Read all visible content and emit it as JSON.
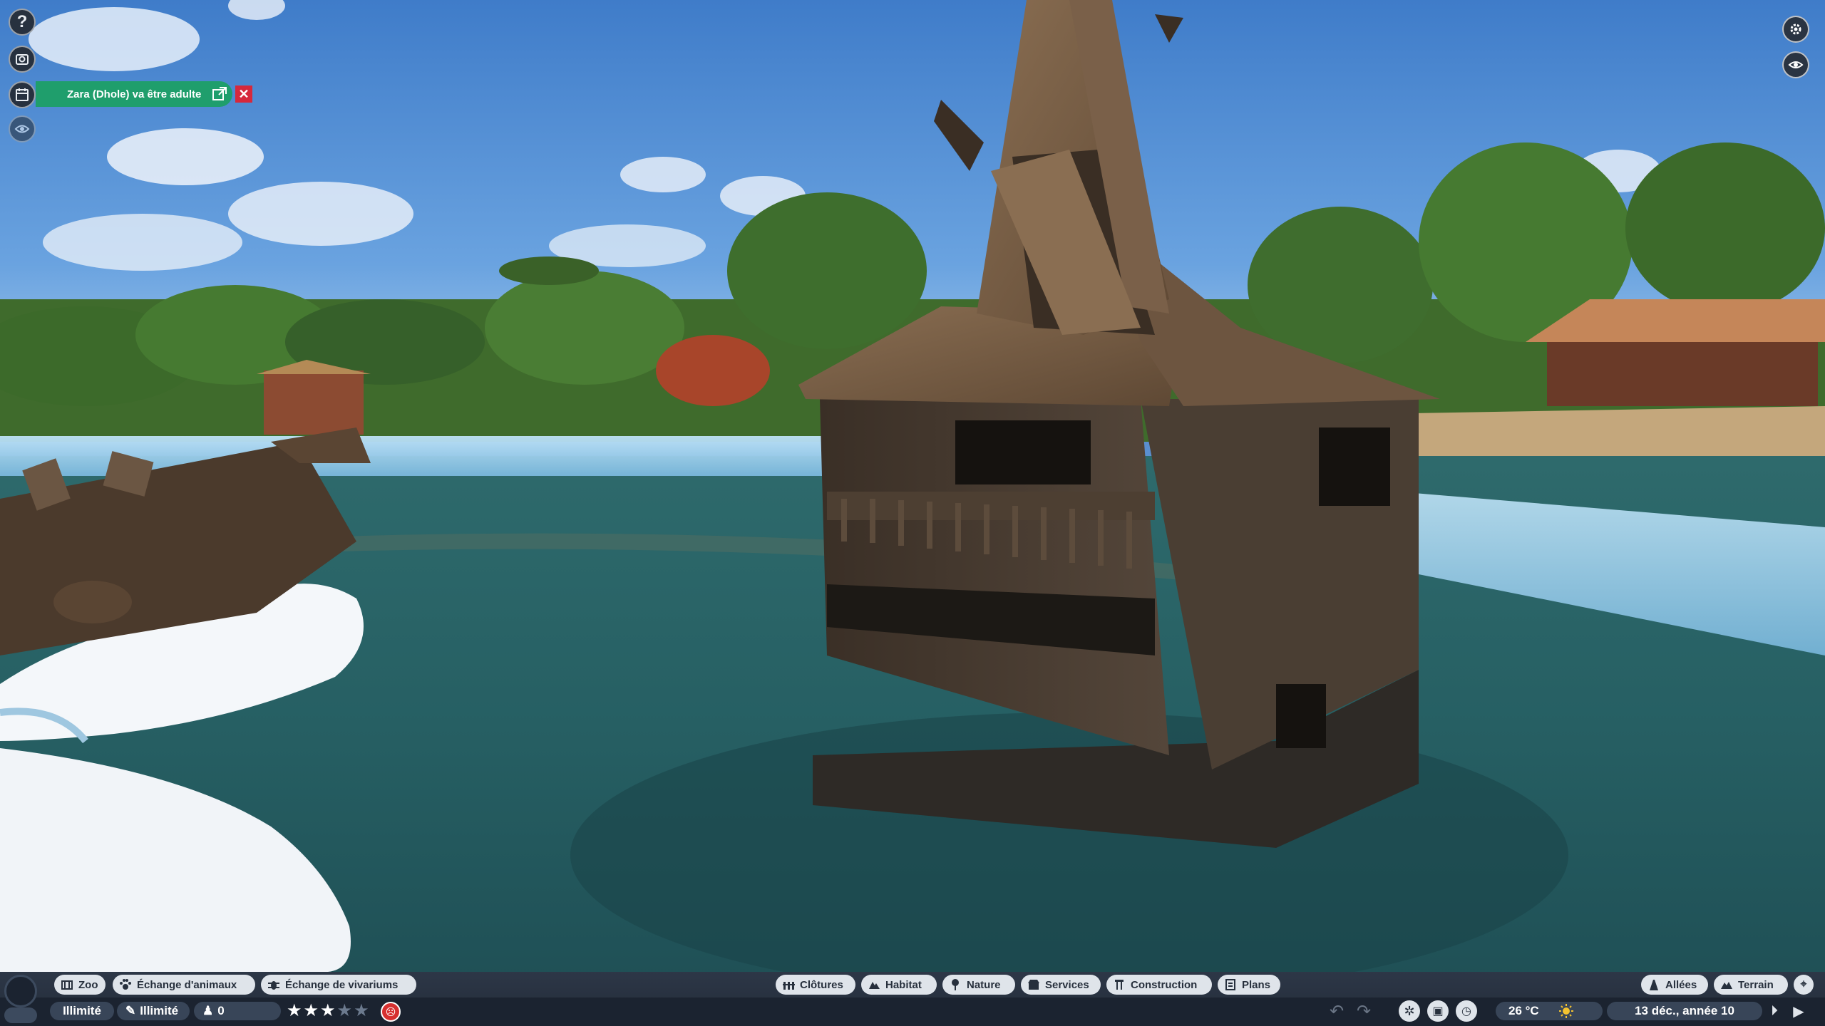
{
  "notification": {
    "text": "Zara (Dhole) va être adulte"
  },
  "left_buttons": {
    "help_glyph": "?"
  },
  "bottom_left_tabs": [
    {
      "label": "Zoo",
      "icon": "zoo-icon"
    },
    {
      "label": "Échange d'animaux",
      "icon": "paw-icon"
    },
    {
      "label": "Échange de vivariums",
      "icon": "bug-icon"
    }
  ],
  "bottom_center_tabs": [
    {
      "label": "Clôtures",
      "icon": "fence-icon"
    },
    {
      "label": "Habitat",
      "icon": "habitat-icon"
    },
    {
      "label": "Nature",
      "icon": "tree-icon"
    },
    {
      "label": "Services",
      "icon": "shop-icon"
    },
    {
      "label": "Construction",
      "icon": "construction-icon"
    },
    {
      "label": "Plans",
      "icon": "blueprint-icon"
    }
  ],
  "bottom_right_tabs": [
    {
      "label": "Allées",
      "icon": "path-icon"
    },
    {
      "label": "Terrain",
      "icon": "terrain-icon"
    }
  ],
  "stats": {
    "money": "Illimité",
    "research": "Illimité",
    "guests": "0",
    "rating_stars": 2.5,
    "rating_max": 5
  },
  "time": {
    "temperature": "26 °C",
    "weather_icon": "sun-icon",
    "date": "13 déc., année 10"
  },
  "colors": {
    "notification_bg": "#1f9e6c",
    "close_red": "#d6283c",
    "bar_bg": "#2d3747",
    "tab_bg": "#dfe4ea",
    "mood_red": "#d63030"
  }
}
